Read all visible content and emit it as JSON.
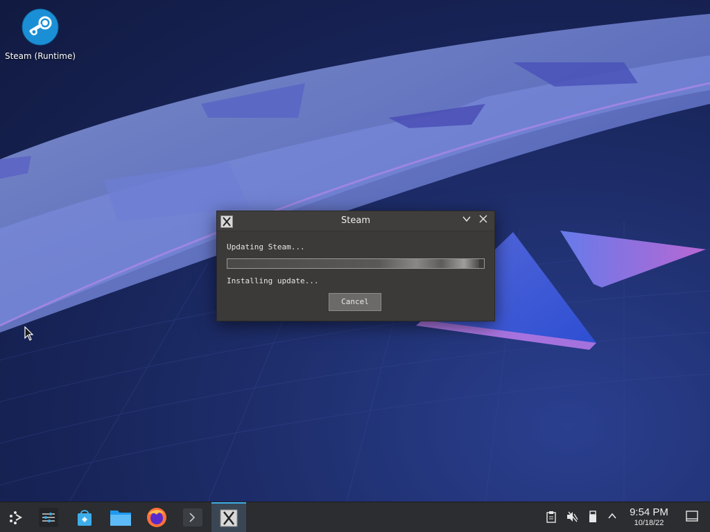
{
  "desktop": {
    "icons": [
      {
        "label": "Steam (Runtime)",
        "icon": "steam-icon"
      }
    ]
  },
  "dialog": {
    "title": "Steam",
    "status": "Updating Steam...",
    "progress": 0.98,
    "detail": "Installing update...",
    "cancel_label": "Cancel"
  },
  "taskbar": {
    "launchers": [
      {
        "name": "application-launcher",
        "icon": "kde-launcher-icon"
      },
      {
        "name": "system-settings",
        "icon": "sliders-icon"
      },
      {
        "name": "discover",
        "icon": "store-bag-icon"
      },
      {
        "name": "dolphin",
        "icon": "folder-icon"
      },
      {
        "name": "firefox",
        "icon": "firefox-icon"
      },
      {
        "name": "konsole",
        "icon": "terminal-icon"
      },
      {
        "name": "steam-window",
        "icon": "x-window-icon"
      }
    ],
    "tray": [
      "clipboard-icon",
      "volume-muted-icon",
      "usb-storage-icon",
      "chevron-up-icon"
    ],
    "clock": {
      "time": "9:54 PM",
      "date": "10/18/22"
    },
    "show_desktop": "show-desktop-icon"
  },
  "colors": {
    "accent": "#3daee9",
    "dialog_bg": "#3b3a38",
    "taskbar_bg": "#2b2d30"
  }
}
